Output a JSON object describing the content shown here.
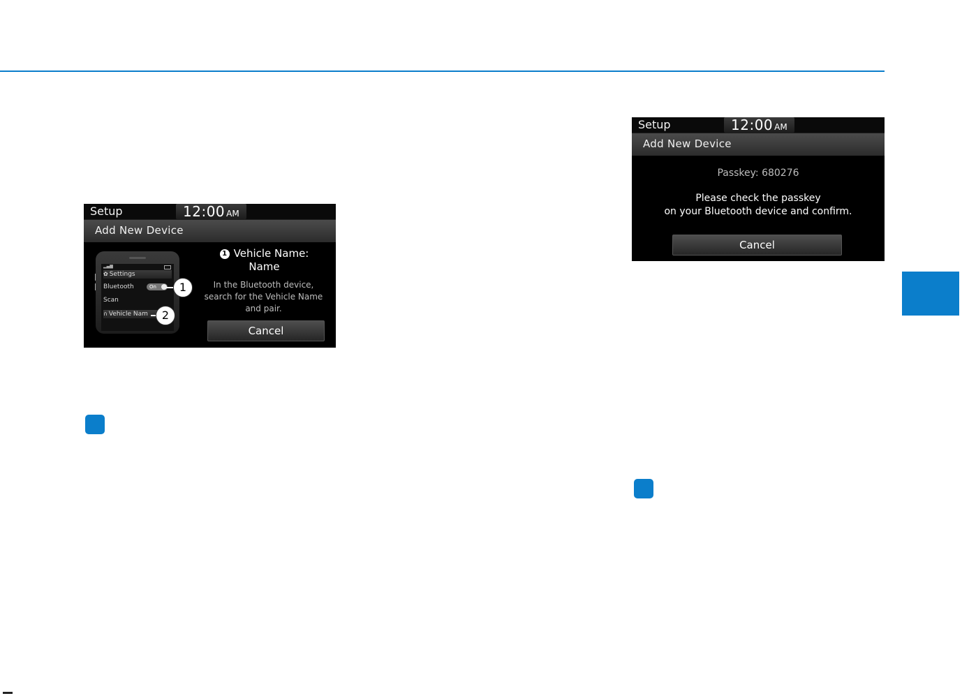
{
  "left_screen": {
    "title": "Setup",
    "time": "12:00",
    "ampm": "AM",
    "subtitle": "Add New Device",
    "phone": {
      "settings_label": "Settings",
      "bluetooth_label": "Bluetooth",
      "toggle_label": "On",
      "scan_label": "Scan",
      "vehicle_label": "Vehicle Nam"
    },
    "callout_1": "1",
    "callout_2": "2",
    "step_number": "1",
    "vehicle_name_label": "Vehicle Name:",
    "vehicle_name_value": "Name",
    "instructions": [
      "In the Bluetooth device,",
      "search for the Vehicle Name",
      "and pair."
    ],
    "cancel": "Cancel"
  },
  "right_screen": {
    "title": "Setup",
    "time": "12:00",
    "ampm": "AM",
    "subtitle": "Add New Device",
    "passkey": "Passkey: 680276",
    "message_line1": "Please check the passkey",
    "message_line2": "on your Bluetooth device and confirm.",
    "cancel": "Cancel"
  },
  "colors": {
    "accent": "#0b7ecb",
    "screen_bg": "#000000"
  }
}
